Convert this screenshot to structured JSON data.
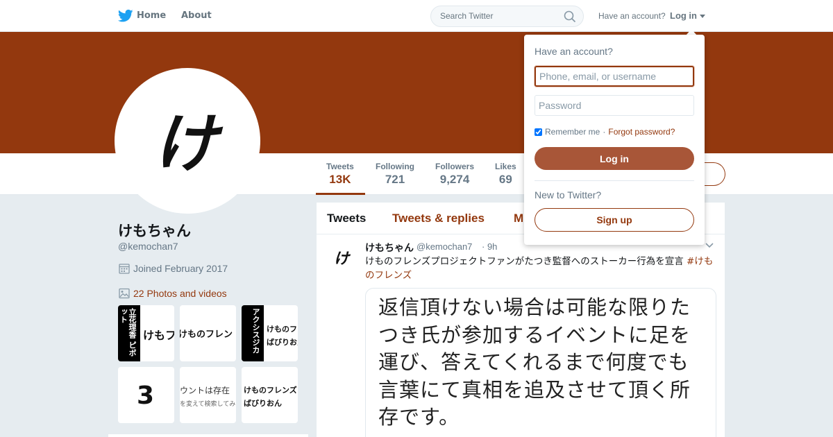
{
  "colors": {
    "brand": "#93380e",
    "twitter_blue": "#1da1f2",
    "muted": "#657786"
  },
  "topnav": {
    "logo_icon": "twitter-bird-icon",
    "home": "Home",
    "about": "About",
    "search_placeholder": "Search Twitter",
    "search_icon": "search-icon",
    "have_account": "Have an account?",
    "login": "Log in"
  },
  "profile": {
    "avatar_glyph": "け",
    "name": "けもちゃん",
    "handle": "@kemochan7",
    "joined": "Joined February 2017",
    "photos": "22 Photos and videos"
  },
  "stats": [
    {
      "label": "Tweets",
      "value": "13K"
    },
    {
      "label": "Following",
      "value": "721"
    },
    {
      "label": "Followers",
      "value": "9,274"
    },
    {
      "label": "Likes",
      "value": "69"
    }
  ],
  "thumbnails": [
    {
      "vertical": "立花理香",
      "side": "ピボット",
      "text": "けもフ"
    },
    {
      "text": "けものフレン"
    },
    {
      "vertical": "アクシスジカ",
      "text": "けものフレ",
      "text2": "ばびりおん"
    },
    {
      "text": "3"
    },
    {
      "text": "ウントは存在",
      "text2": "を変えて検索してみ"
    },
    {
      "text": "けものフレンズ",
      "text2": "ばびりおん"
    }
  ],
  "timeline": {
    "tabs": [
      "Tweets",
      "Tweets & replies",
      "M"
    ],
    "tweet": {
      "avatar_glyph": "け",
      "name": "けもちゃん",
      "handle": "@kemochan7",
      "time": "· 9h",
      "text": "けものフレンズプロジェクトファンがたつき監督へのストーカー行為を宣言 ",
      "hashtag": "#けものフレンズ",
      "media_text": "返信頂けない場合は可能な限りたつき氏が参加するイベントに足を運び、答えてくれるまで何度でも言葉にて真相を追及させて頂く所存です。"
    }
  },
  "login_dropdown": {
    "title": "Have an account?",
    "username_placeholder": "Phone, email, or username",
    "password_placeholder": "Password",
    "remember": "Remember me",
    "separator": "·",
    "forgot": "Forgot password?",
    "login_button": "Log in",
    "new_to_twitter": "New to Twitter?",
    "signup_button": "Sign up"
  }
}
